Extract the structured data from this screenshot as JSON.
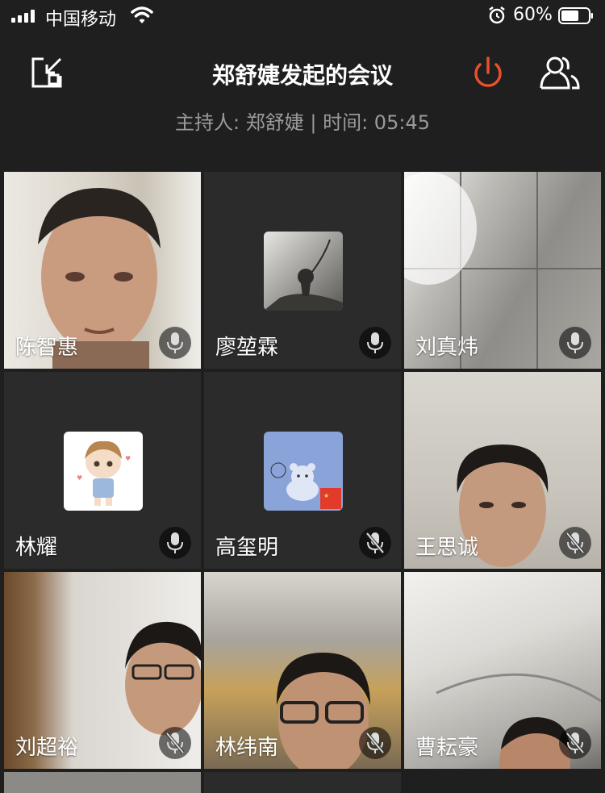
{
  "status_bar": {
    "carrier": "中国移动",
    "battery_percent": "60%",
    "battery_level": 0.6,
    "icons": [
      "signal-icon",
      "wifi-icon",
      "alarm-icon",
      "battery-icon"
    ]
  },
  "header": {
    "title": "郑舒婕发起的会议",
    "subtitle": "主持人: 郑舒婕 | 时间: 05:45",
    "icons": [
      "shrink-window-icon",
      "power-icon",
      "members-icon"
    ],
    "power_color": "#e8502d"
  },
  "participants": [
    {
      "name": "陈智惠",
      "mic": "mic-icon",
      "video": true
    },
    {
      "name": "廖堃霖",
      "mic": "mic-icon",
      "video": false
    },
    {
      "name": "刘真炜",
      "mic": "mic-icon",
      "video": true
    },
    {
      "name": "林耀",
      "mic": "mic-icon",
      "video": false
    },
    {
      "name": "高玺明",
      "mic": "mic-muted-icon",
      "video": false
    },
    {
      "name": "王思诚",
      "mic": "mic-muted-icon",
      "video": true
    },
    {
      "name": "刘超裕",
      "mic": "mic-muted-icon",
      "video": true
    },
    {
      "name": "林纬南",
      "mic": "mic-muted-icon",
      "video": true
    },
    {
      "name": "曹耘豪",
      "mic": "mic-muted-icon",
      "video": true
    }
  ]
}
